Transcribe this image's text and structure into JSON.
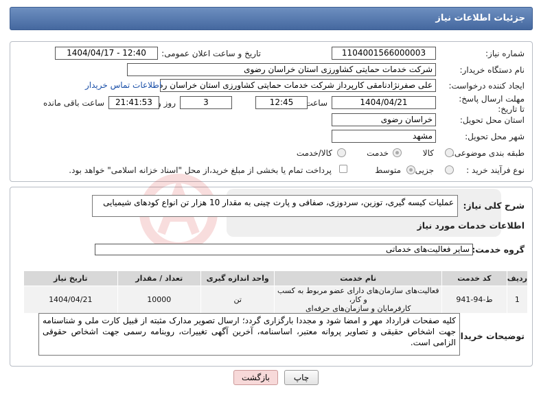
{
  "header": {
    "title": "جزئیات اطلاعات نیاز"
  },
  "fields": {
    "need_number_label": "شماره نیاز:",
    "need_number": "1104001566000003",
    "announce_label": "تاریخ و ساعت اعلان عمومی:",
    "announce_value": "1404/04/17 - 12:40",
    "buyer_org_label": "نام دستگاه خریدار:",
    "buyer_org": "شرکت خدمات حمایتی کشاورزی استان خراسان رضوی",
    "creator_label": "ایجاد کننده درخواست:",
    "creator": "علی صفرنژادنامقی کارپرداز شرکت خدمات حمایتی کشاورزی استان خراسان رضوی",
    "contact_link": "اطلاعات تماس خریدار",
    "deadline_label": "مهلت ارسال پاسخ: تا تاریخ:",
    "deadline_date": "1404/04/21",
    "time_label": "ساعت",
    "deadline_time": "12:45",
    "days_value": "3",
    "days_label": "روز و",
    "remaining_time": "21:41:53",
    "remaining_label": "ساعت باقی مانده",
    "province_label": "استان محل تحویل:",
    "province": "خراسان رضوی",
    "city_label": "شهر محل تحویل:",
    "city": "مشهد",
    "category_label": "طبقه بندی موضوعی:",
    "category_options": [
      "کالا",
      "خدمت",
      "کالا/خدمت"
    ],
    "category_selected": "خدمت",
    "process_label": "نوع فرآیند خرید :",
    "process_options": [
      "جزیی",
      "متوسط"
    ],
    "process_selected": "متوسط",
    "payment_note": "پرداخت تمام یا بخشی از مبلغ خرید،از محل \"اسناد خزانه اسلامی\" خواهد بود."
  },
  "description": {
    "label": "شرح کلی نیاز:",
    "text": "عملیات کیسه گیری، توزین، سردوزی، صفافی و پارت چینی به مقدار 10 هزار تن انواع کودهای شیمیایی"
  },
  "services": {
    "section_title": "اطلاعات خدمات مورد نیاز",
    "group_label": "گروه خدمت:",
    "group_value": "سایر فعالیت‌های خدماتی",
    "columns": [
      "ردیف",
      "کد خدمت",
      "نام خدمت",
      "واحد اندازه گیری",
      "تعداد / مقدار",
      "تاریخ نیاز"
    ],
    "rows": [
      {
        "row": "1",
        "code": "ط-94-941",
        "name_line1": "فعالیت‌های سازمان‌های دارای عضو مربوط به کسب و کار،",
        "name_line2": "کارفرمایان و سازمان‌های حرفه‌ای",
        "unit": "تن",
        "qty": "10000",
        "date": "1404/04/21"
      }
    ]
  },
  "buyer_notes": {
    "label": "توضیحات خریدار:",
    "text": "کلیه صفحات قرارداد مهر و امضا شود و مجددا بارگزاری گردد؛ ارسال تصویر مدارک مثبته از قبیل کارت ملی و شناسنامه جهت اشخاص حقیقی و تصاویر پروانه معتبر، اساسنامه، آخرین آگهی تغییرات، روبنامه رسمی جهت اشخاص حقوقی الزامی است."
  },
  "buttons": {
    "print": "چاپ",
    "back": "بازگشت"
  },
  "colors": {
    "header": "#45689f",
    "link": "#1a4fa8",
    "back_button": "#f7d9d9"
  }
}
